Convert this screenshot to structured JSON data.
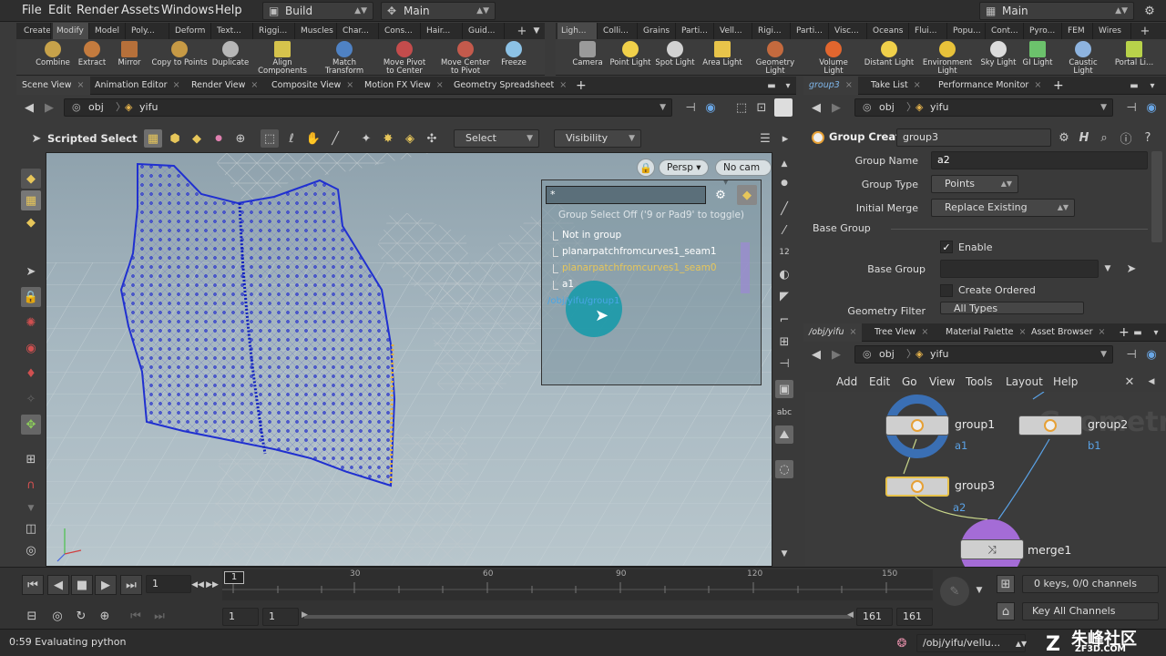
{
  "menu": [
    "File",
    "Edit",
    "Render",
    "Assets",
    "Windows",
    "Help"
  ],
  "desktop_left": "Build",
  "desktop_mid": "Main",
  "desktop_right": "Main",
  "shelf_left_tabs": [
    "Create",
    "Modify",
    "Model",
    "Poly...",
    "Deform",
    "Text...",
    "Riggi...",
    "Muscles",
    "Char...",
    "Cons...",
    "Hair...",
    "Guid..."
  ],
  "shelf_right_tabs": [
    "Ligh...",
    "Colli...",
    "Grains",
    "Parti...",
    "Vell...",
    "Rigi...",
    "Parti...",
    "Visc...",
    "Oceans",
    "Flui...",
    "Popu...",
    "Cont...",
    "Pyro...",
    "FEM",
    "Wires"
  ],
  "tools_left": [
    "Combine",
    "Extract",
    "Mirror",
    "Copy to Points",
    "Duplicate",
    "Align Components",
    "Match Transform",
    "Move Pivot to Center",
    "Move Center to Pivot",
    "Freeze"
  ],
  "tools_right": [
    "Camera",
    "Point Light",
    "Spot Light",
    "Area Light",
    "Geometry Light",
    "Volume Light",
    "Distant Light",
    "Environment Light",
    "Sky Light",
    "GI Light",
    "Caustic Light",
    "Portal Li..."
  ],
  "left_tabs": [
    "Scene View",
    "Animation Editor",
    "Render View",
    "Composite View",
    "Motion FX View",
    "Geometry Spreadsheet"
  ],
  "right_top_tabs": [
    "group3",
    "Take List",
    "Performance Monitor"
  ],
  "path": {
    "obj": "obj",
    "node": "yifu"
  },
  "viewer": {
    "tool_label": "Scripted Select",
    "select_label": "Select",
    "visibility_label": "Visibility",
    "persp": "Persp",
    "cam": "No cam"
  },
  "group_panel": {
    "filter": "*",
    "hint": "Group Select Off ('9 or Pad9' to toggle)",
    "items": [
      "Not in group",
      "planarpatchfromcurves1_seam1",
      "planarpatchfromcurves1_seam0",
      "a1"
    ],
    "hover_path": "/obj/yifu/group1"
  },
  "params": {
    "node_type": "Group Create",
    "node_name": "group3",
    "group_name_label": "Group Name",
    "group_name": "a2",
    "group_type_label": "Group Type",
    "group_type": "Points",
    "initial_merge_label": "Initial Merge",
    "initial_merge": "Replace Existing",
    "base_group_section": "Base Group",
    "enable_label": "Enable",
    "base_group_label": "Base Group",
    "create_ordered_label": "Create Ordered",
    "geometry_filter_label": "Geometry Filter",
    "geometry_filter": "All Types"
  },
  "net_tabs": [
    "/obj/yifu",
    "Tree View",
    "Material Palette",
    "Asset Browser"
  ],
  "net_menu": [
    "Add",
    "Edit",
    "Go",
    "View",
    "Tools",
    "Layout",
    "Help"
  ],
  "net_watermark": "Geometry",
  "nodes": [
    {
      "name": "group1",
      "sub": "a1"
    },
    {
      "name": "group2",
      "sub": "b1"
    },
    {
      "name": "group3",
      "sub": "a2"
    },
    {
      "name": "merge1",
      "sub": ""
    }
  ],
  "timeline": {
    "frame": "1",
    "start_marker": "1",
    "ticks": [
      "30",
      "60",
      "90",
      "120",
      "150"
    ],
    "range_start": "1",
    "range_start2": "1",
    "range_end": "161",
    "range_end2": "161",
    "keys_info": "0 keys, 0/0 channels",
    "key_all": "Key All Channels"
  },
  "status": {
    "text": "0:59 Evaluating python",
    "path": "/obj/yifu/vellu..."
  },
  "watermark": {
    "brand": "朱峰社区",
    "site": "ZF3D.COM"
  }
}
